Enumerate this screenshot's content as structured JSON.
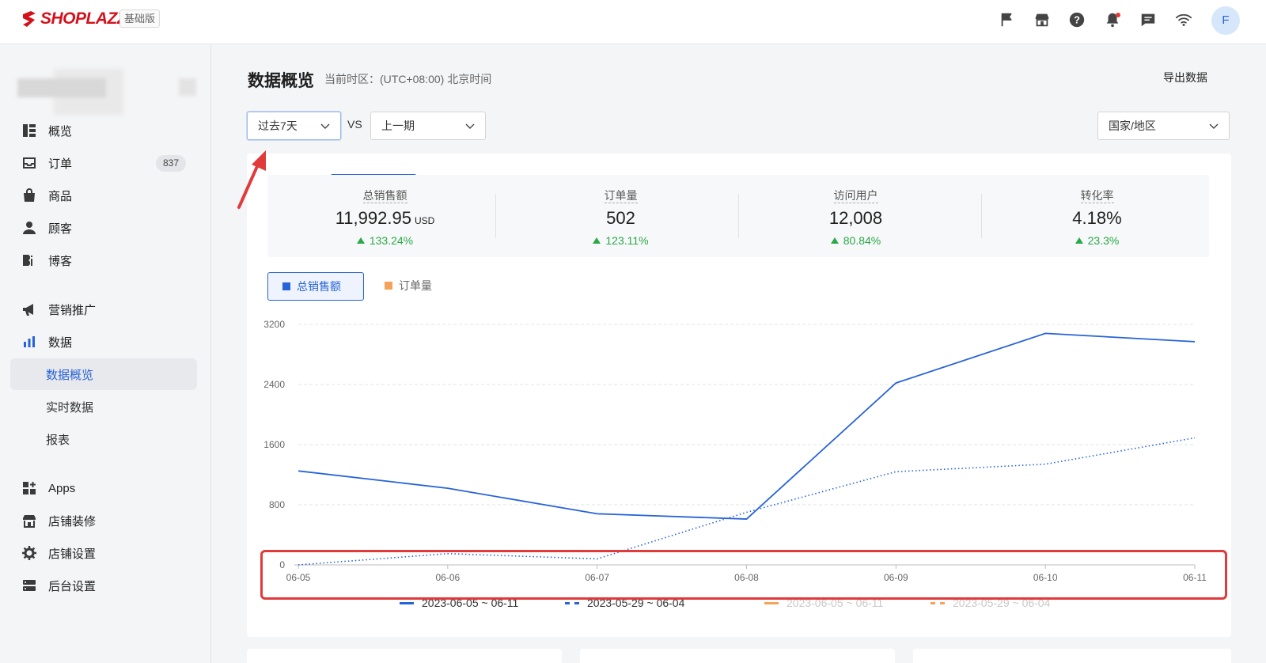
{
  "brand": {
    "name": "SHOPLAZZA",
    "plan": "基础版",
    "brand_color": "#d4111b"
  },
  "header": {
    "icons": [
      "flag-icon",
      "store-icon",
      "help-icon",
      "bell-icon",
      "message-icon",
      "wifi-icon"
    ],
    "avatar_initial": "F"
  },
  "sidebar": {
    "items": [
      {
        "label": "概览",
        "icon": "overview-icon"
      },
      {
        "label": "订单",
        "icon": "inbox-icon",
        "count": "837"
      },
      {
        "label": "商品",
        "icon": "bag-icon"
      },
      {
        "label": "顾客",
        "icon": "user-icon"
      },
      {
        "label": "博客",
        "icon": "blog-icon"
      },
      {
        "label": "营销推广",
        "icon": "megaphone-icon"
      },
      {
        "label": "数据",
        "icon": "bar-chart-icon"
      },
      {
        "label": "数据概览",
        "sub": true,
        "active": true
      },
      {
        "label": "实时数据",
        "sub": true
      },
      {
        "label": "报表",
        "sub": true
      },
      {
        "label": "Apps",
        "icon": "apps-icon"
      },
      {
        "label": "店铺装修",
        "icon": "storefront-icon"
      },
      {
        "label": "店铺设置",
        "icon": "gear-icon"
      },
      {
        "label": "后台设置",
        "icon": "server-icon"
      }
    ]
  },
  "main": {
    "title": "数据概览",
    "timezone": "当前时区：(UTC+08:00) 北京时间",
    "export_label": "导出数据",
    "range_select": "过去7天",
    "vs_label": "VS",
    "compare_select": "上一期",
    "region_select": "国家/地区",
    "metrics": [
      {
        "label": "总销售额",
        "value": "11,992.95",
        "unit": "USD",
        "change": "133.24%"
      },
      {
        "label": "订单量",
        "value": "502",
        "unit": "",
        "change": "123.11%"
      },
      {
        "label": "访问用户",
        "value": "12,008",
        "unit": "",
        "change": "80.84%"
      },
      {
        "label": "转化率",
        "value": "4.18%",
        "unit": "",
        "change": "23.3%"
      }
    ],
    "chart_tabs": [
      {
        "label": "总销售额",
        "color": "#2763d8",
        "active": true
      },
      {
        "label": "订单量",
        "color": "#f5a25d",
        "active": false
      }
    ]
  },
  "colors": {
    "accent": "#2763d8",
    "positive": "#2aa84a",
    "orange": "#f5a25d",
    "annotation": "#e03a3a"
  },
  "chart_data": {
    "type": "line",
    "categories": [
      "06-05",
      "06-06",
      "06-07",
      "06-08",
      "06-09",
      "06-10",
      "06-11"
    ],
    "yticks": [
      0,
      800,
      1600,
      2400,
      3200
    ],
    "ylim": [
      0,
      3200
    ],
    "grid": true,
    "legend_position": "bottom",
    "series": [
      {
        "name": "2023-06-05 ~ 06-11",
        "style": "solid",
        "color": "#2763d8",
        "values": [
          1250,
          1020,
          680,
          610,
          2420,
          3080,
          2970
        ]
      },
      {
        "name": "2023-05-29 ~ 06-04",
        "style": "dotted",
        "color": "#2763d8",
        "values": [
          0,
          150,
          80,
          700,
          1240,
          1340,
          1690
        ]
      }
    ],
    "faded_legend": [
      {
        "name": "2023-06-05 ~ 06-11",
        "style": "solid",
        "color": "#f5a25d"
      },
      {
        "name": "2023-05-29 ~ 06-04",
        "style": "dashed",
        "color": "#f5a25d"
      }
    ]
  }
}
